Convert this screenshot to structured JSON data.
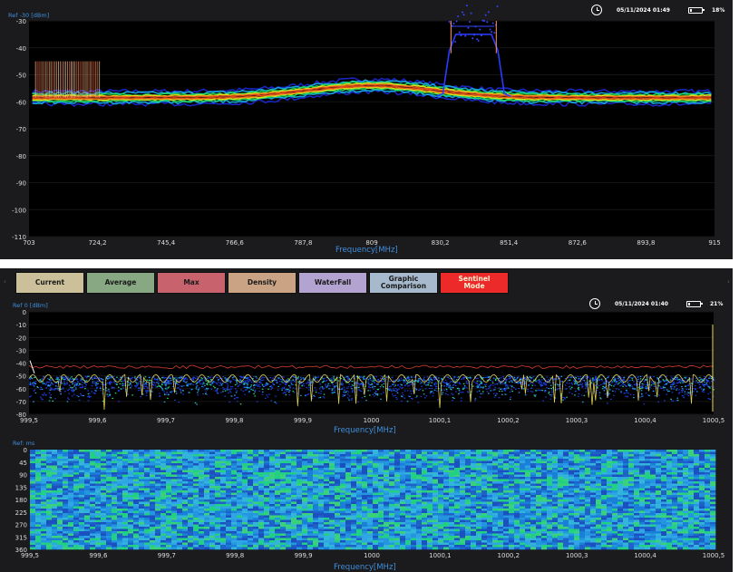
{
  "top_panel": {
    "ref_label": "Ref -30 [dBm]",
    "datetime": "05/11/2024 01:49",
    "battery": "18%",
    "battery_level": 0.18,
    "xlabel": "Frequency[MHz]"
  },
  "tabs": [
    {
      "label": "Current",
      "color": "#ccc09a"
    },
    {
      "label": "Average",
      "color": "#87a882"
    },
    {
      "label": "Max",
      "color": "#c8636e"
    },
    {
      "label": "Density",
      "color": "#c9a384"
    },
    {
      "label": "WaterFall",
      "color": "#b2a3d0"
    },
    {
      "label": "Graphic Comparison",
      "color": "#a7b9cd"
    },
    {
      "label": "Sentinel Mode",
      "color": "#ec2a2a"
    }
  ],
  "bottom_panel": {
    "ref_label": "Ref  0 [dBm]",
    "datetime": "05/11/2024 01:40",
    "battery": "21%",
    "battery_level": 0.21,
    "xlabel": "Frequency[MHz]",
    "waterfall_ref_label": "Ref: ms",
    "waterfall_xlabel": "Frequency[MHz]"
  },
  "chart_data": [
    {
      "type": "line",
      "name": "top-spectrum",
      "x_ticks": [
        "703",
        "724,2",
        "745,4",
        "766,6",
        "787,8",
        "809",
        "830,2",
        "851,4",
        "872,6",
        "893,8",
        "915"
      ],
      "y_ticks": [
        "-30",
        "-40",
        "-50",
        "-60",
        "-70",
        "-80",
        "-90",
        "-100",
        "-110"
      ],
      "xlim": [
        703,
        915
      ],
      "ylim": [
        -110,
        -30
      ],
      "noise_floor": -58.5,
      "hump": {
        "center": 809,
        "width": 28,
        "peak": -54
      },
      "signal_bursts": [
        {
          "from": 705,
          "to": 716,
          "level": -32
        },
        {
          "from": 716,
          "to": 725,
          "level": -40
        },
        {
          "from": 833,
          "to": 848,
          "level": -30
        }
      ],
      "xlabel": "Frequency[MHz]"
    },
    {
      "type": "line",
      "name": "bottom-spectrum",
      "x_ticks": [
        "999,5",
        "999,6",
        "999,7",
        "999,8",
        "999,9",
        "1000",
        "1000,1",
        "1000,2",
        "1000,3",
        "1000,4",
        "1000,5"
      ],
      "y_ticks": [
        "0",
        "-10",
        "-20",
        "-30",
        "-40",
        "-50",
        "-60",
        "-70",
        "-80"
      ],
      "xlim": [
        999.5,
        1000.5
      ],
      "ylim": [
        -80,
        0
      ],
      "max_trace": -43,
      "current_trace_avg": -52,
      "xlabel": "Frequency[MHz]"
    },
    {
      "type": "heatmap",
      "name": "waterfall",
      "x_ticks": [
        "999,5",
        "999,6",
        "999,7",
        "999,8",
        "999,9",
        "1000",
        "1000,1",
        "1000,2",
        "1000,3",
        "1000,4",
        "1000,5"
      ],
      "y_ticks": [
        "0",
        "45",
        "90",
        "135",
        "180",
        "225",
        "270",
        "315",
        "360"
      ],
      "xlim": [
        999.5,
        1000.5
      ],
      "ylim": [
        0,
        360
      ],
      "xlabel": "Frequency[MHz]"
    }
  ]
}
